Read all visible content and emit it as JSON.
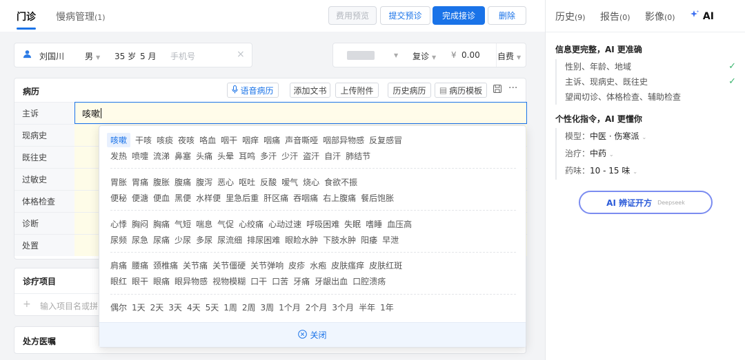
{
  "top_tabs": [
    {
      "label": "门诊",
      "count": ""
    },
    {
      "label": "慢病管理",
      "count": "(1)"
    }
  ],
  "top_buttons": {
    "fee_preview": "费用预览",
    "submit_precheck": "提交预诊",
    "complete": "完成接诊",
    "delete": "删除"
  },
  "patient": {
    "name": "刘国川",
    "gender": "男",
    "age_years": "35 岁",
    "age_months": "5 月",
    "phone_placeholder": "手机号"
  },
  "fee": {
    "visit_type": "复诊",
    "currency": "¥",
    "amount": "0.00",
    "pay_type": "自费"
  },
  "record": {
    "title": "病历",
    "buttons": {
      "voice": "语音病历",
      "add_text": "添加文书",
      "upload": "上传附件",
      "history": "历史病历",
      "template": "病历模板"
    },
    "rows": [
      "主诉",
      "现病史",
      "既往史",
      "过敏史",
      "体格检查",
      "诊断",
      "处置"
    ],
    "chief_complaint_value": "咳嗽"
  },
  "treatment": {
    "title": "诊疗项目",
    "add_placeholder": "输入项目名或拼"
  },
  "prescription": {
    "title": "处方医嘱"
  },
  "symptom_groups": [
    [
      [
        "咳嗽",
        "干咳",
        "咳痰",
        "夜咳",
        "咯血",
        "咽干",
        "咽痒",
        "咽痛",
        "声音嘶哑",
        "咽部异物感",
        "反复感冒"
      ],
      [
        "发热",
        "喷嚏",
        "流涕",
        "鼻塞",
        "头痛",
        "头晕",
        "耳鸣",
        "多汗",
        "少汗",
        "盗汗",
        "自汗",
        "肺结节"
      ]
    ],
    [
      [
        "胃胀",
        "胃痛",
        "腹胀",
        "腹痛",
        "腹泻",
        "恶心",
        "呕吐",
        "反酸",
        "嗳气",
        "烧心",
        "食欲不振"
      ],
      [
        "便秘",
        "便溏",
        "便血",
        "黑便",
        "水样便",
        "里急后重",
        "肝区痛",
        "吞咽痛",
        "右上腹痛",
        "餐后饱胀"
      ]
    ],
    [
      [
        "心悸",
        "胸闷",
        "胸痛",
        "气短",
        "喘息",
        "气促",
        "心绞痛",
        "心动过速",
        "呼吸困难",
        "失眠",
        "嗜睡",
        "血压高"
      ],
      [
        "尿频",
        "尿急",
        "尿痛",
        "少尿",
        "多尿",
        "尿流细",
        "排尿困难",
        "眼睑水肿",
        "下肢水肿",
        "阳痿",
        "早泄"
      ]
    ],
    [
      [
        "肩痛",
        "腰痛",
        "颈椎痛",
        "关节痛",
        "关节僵硬",
        "关节弹响",
        "皮疹",
        "水疱",
        "皮肤瘙痒",
        "皮肤红斑"
      ],
      [
        "眼红",
        "眼干",
        "眼痛",
        "眼异物感",
        "视物模糊",
        "口干",
        "口苦",
        "牙痛",
        "牙龈出血",
        "口腔溃疡"
      ]
    ],
    [
      [
        "偶尔",
        "1天",
        "2天",
        "3天",
        "4天",
        "5天",
        "1周",
        "2周",
        "3周",
        "1个月",
        "2个月",
        "3个月",
        "半年",
        "1年"
      ]
    ]
  ],
  "dropdown_close": "关闭",
  "right_tabs": [
    {
      "label": "历史",
      "count": "(9)"
    },
    {
      "label": "报告",
      "count": "(0)"
    },
    {
      "label": "影像",
      "count": "(0)"
    },
    {
      "label": "AI",
      "count": ""
    }
  ],
  "ai_panel": {
    "info_title": "信息更完整，AI 更准确",
    "info_items": [
      {
        "text": "性别、年龄、地域",
        "done": true
      },
      {
        "text": "主诉、现病史、既往史",
        "done": true
      },
      {
        "text": "望闻切诊、体格检查、辅助检查",
        "done": false
      }
    ],
    "pref_title": "个性化指令，AI 更懂你",
    "prefs": [
      {
        "label": "模型：",
        "value": "中医 · 伤寒派"
      },
      {
        "label": "治疗：",
        "value": "中药"
      },
      {
        "label": "药味：",
        "value": "10 - 15 味"
      }
    ],
    "button_label": "AI 辨证开方",
    "button_sub": "Deepseek"
  },
  "colors": {
    "primary": "#1a73e8",
    "check": "#3bb56e",
    "field_bg": "#fefce8",
    "ai_border": "#7b8cf0"
  }
}
